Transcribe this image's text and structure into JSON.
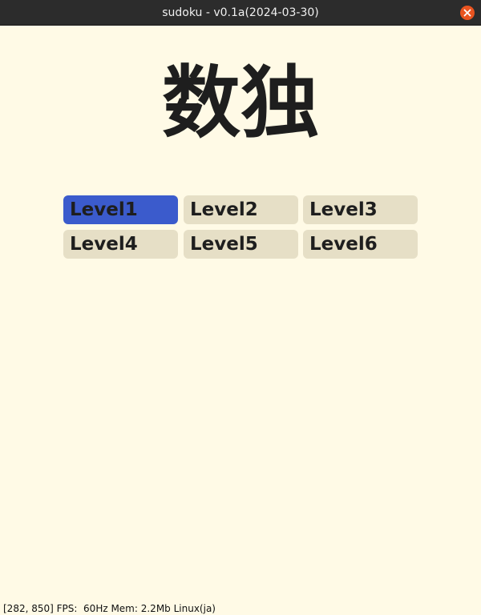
{
  "window": {
    "title": "sudoku - v0.1a(2024-03-30)",
    "close_icon": "close-icon"
  },
  "heading": "数独",
  "levels": [
    {
      "label": "Level1",
      "selected": true
    },
    {
      "label": "Level2",
      "selected": false
    },
    {
      "label": "Level3",
      "selected": false
    },
    {
      "label": "Level4",
      "selected": false
    },
    {
      "label": "Level5",
      "selected": false
    },
    {
      "label": "Level6",
      "selected": false
    }
  ],
  "status": "[282, 850] FPS:  60Hz Mem: 2.2Mb Linux(ja)",
  "colors": {
    "background": "#fffae6",
    "button": "#e6dfc6",
    "button_selected": "#3b5bcc",
    "titlebar": "#2c2c2c",
    "close_button": "#e95420"
  }
}
